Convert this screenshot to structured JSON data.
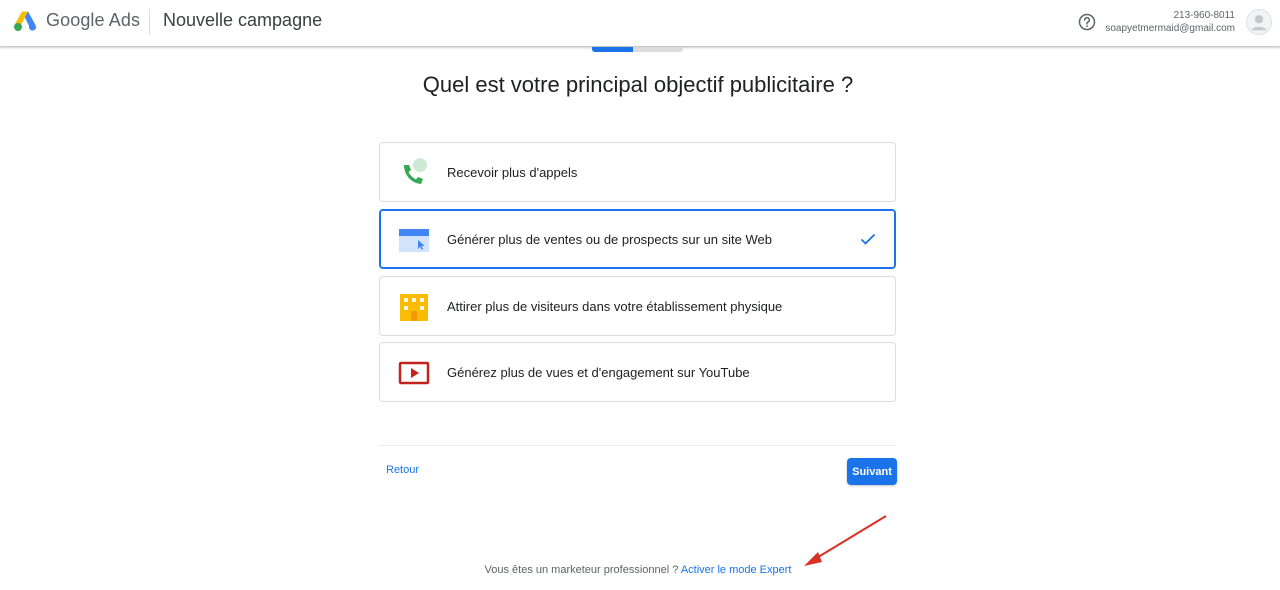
{
  "app": {
    "brand": "Google Ads",
    "page_heading": "Nouvelle campagne",
    "icons": {
      "logo": "google-ads-logo",
      "help": "help-circle-icon",
      "avatar": "user-avatar"
    }
  },
  "account": {
    "phone": "213-960-8011",
    "email": "soapyetmermaid@gmail.com"
  },
  "progress": {
    "fraction": 0.45
  },
  "question": "Quel est votre principal objectif publicitaire ?",
  "options": [
    {
      "label": "Recevoir plus d'appels",
      "icon": "phone-call-icon",
      "selected": false
    },
    {
      "label": "Générer plus de ventes ou de prospects sur un site Web",
      "icon": "website-click-icon",
      "selected": true
    },
    {
      "label": "Attirer plus de visiteurs dans votre établissement physique",
      "icon": "store-building-icon",
      "selected": false
    },
    {
      "label": "Générez plus de vues et d'engagement sur YouTube",
      "icon": "youtube-play-icon",
      "selected": false
    }
  ],
  "footer": {
    "back_label": "Retour",
    "next_label": "Suivant"
  },
  "expert": {
    "prompt": "Vous êtes un marketeur professionnel ?",
    "link": "Activer le mode Expert"
  },
  "colors": {
    "accent": "#1a73e8",
    "annotation_arrow": "#d93025"
  }
}
